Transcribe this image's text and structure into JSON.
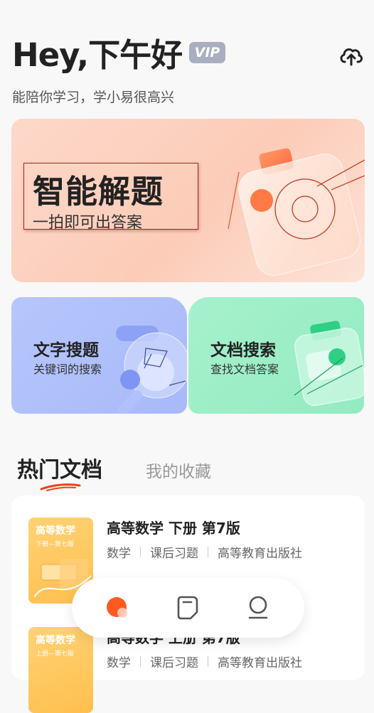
{
  "header": {
    "greeting": "Hey,下午好",
    "vip_label": "VIP",
    "subtitle": "能陪你学习，学小易很高兴",
    "upload_icon": "cloud-upload-icon"
  },
  "banner": {
    "title": "智能解题",
    "subtitle": "一拍即可出答案",
    "icon": "camera-icon"
  },
  "cards": [
    {
      "title": "文字搜题",
      "subtitle": "关键词的搜索",
      "icon": "text-search-icon",
      "color": "#aebffb"
    },
    {
      "title": "文档搜索",
      "subtitle": "查找文档答案",
      "icon": "document-search-icon",
      "color": "#9aeec6"
    }
  ],
  "tabs": {
    "active": "热门文档",
    "inactive": "我的收藏",
    "accent": "#e8441e"
  },
  "documents": [
    {
      "title": "高等数学 下册 第7版",
      "tags": [
        "数学",
        "课后习题",
        "高等教育出版社"
      ],
      "cover_title": "高等数学",
      "cover_sub": "下册—第七版"
    },
    {
      "title": "高等数学 上册 第7版",
      "tags": [
        "数学",
        "课后习题",
        "高等教育出版社"
      ],
      "cover_title": "高等数学",
      "cover_sub": "上册—第七版"
    }
  ],
  "tabbar": {
    "items": [
      {
        "icon": "home-icon",
        "active": true
      },
      {
        "icon": "document-icon",
        "active": false
      },
      {
        "icon": "profile-icon",
        "active": false
      }
    ]
  }
}
